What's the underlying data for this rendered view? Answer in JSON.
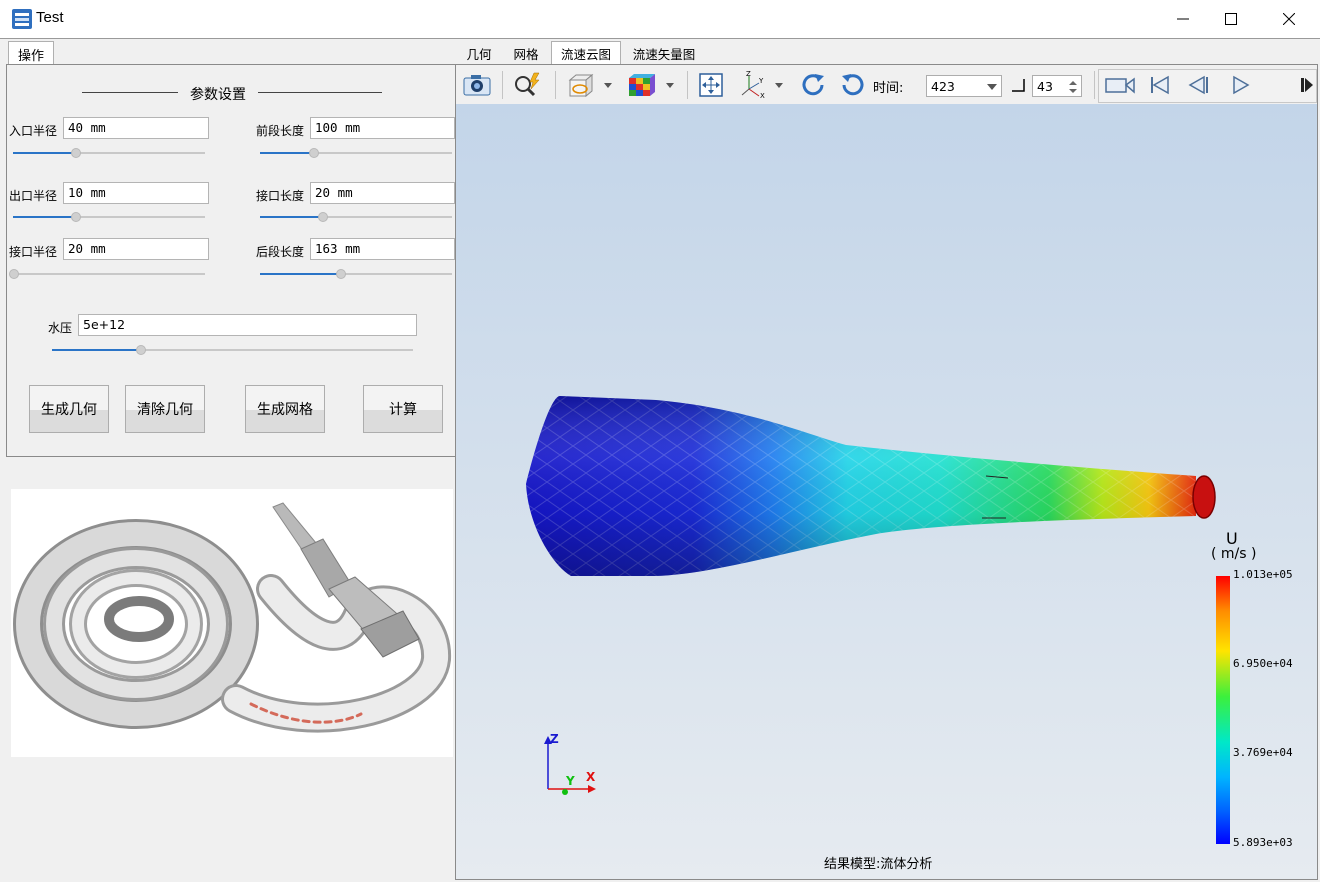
{
  "window": {
    "title": "Test",
    "controls": [
      "minimize-icon",
      "maximize-icon",
      "close-icon"
    ]
  },
  "left": {
    "tab": "操作",
    "section_title": "参数设置",
    "params": [
      {
        "label": "入口半径",
        "value": "40 mm",
        "slider": 0.33
      },
      {
        "label": "前段长度",
        "value": "100 mm",
        "slider": 0.28
      },
      {
        "label": "出口半径",
        "value": "10 mm",
        "slider": 0.33
      },
      {
        "label": "接口长度",
        "value": "20 mm",
        "slider": 0.33
      },
      {
        "label": "接口半径",
        "value": "20 mm",
        "slider": 0.0
      },
      {
        "label": "后段长度",
        "value": "163 mm",
        "slider": 0.42
      }
    ],
    "pressure": {
      "label": "水压",
      "value": "5e+12",
      "slider": 0.25
    },
    "buttons": [
      "生成几何",
      "清除几何",
      "生成网格",
      "计算"
    ]
  },
  "right": {
    "tabs": [
      "几何",
      "网格",
      "流速云图",
      "流速矢量图"
    ],
    "active_tab": 2,
    "toolbar": {
      "time_label": "时间:",
      "time_value": "423",
      "step_value": "43",
      "icons": [
        "camera-icon",
        "zoom-select-icon",
        "view-box-icon",
        "color-cube-icon",
        "fit-view-icon",
        "axes-icon",
        "rotate-cw-icon",
        "rotate-ccw-icon",
        "video-record-icon",
        "first-frame-icon",
        "prev-frame-icon",
        "play-icon",
        "next-frame-icon"
      ]
    },
    "legend": {
      "title": "U",
      "unit": "( m/s )",
      "ticks": [
        "1.013e+05",
        "6.950e+04",
        "3.769e+04",
        "5.893e+03"
      ]
    },
    "axes_labels": {
      "z": "Z",
      "y": "Y",
      "x": "X"
    },
    "footer": "结果模型:流体分析",
    "colors": {
      "legend_top": "#ff0000",
      "legend_bottom": "#0000ff",
      "model_inlet": "#1a1ad6",
      "model_outlet": "#e01010"
    }
  }
}
